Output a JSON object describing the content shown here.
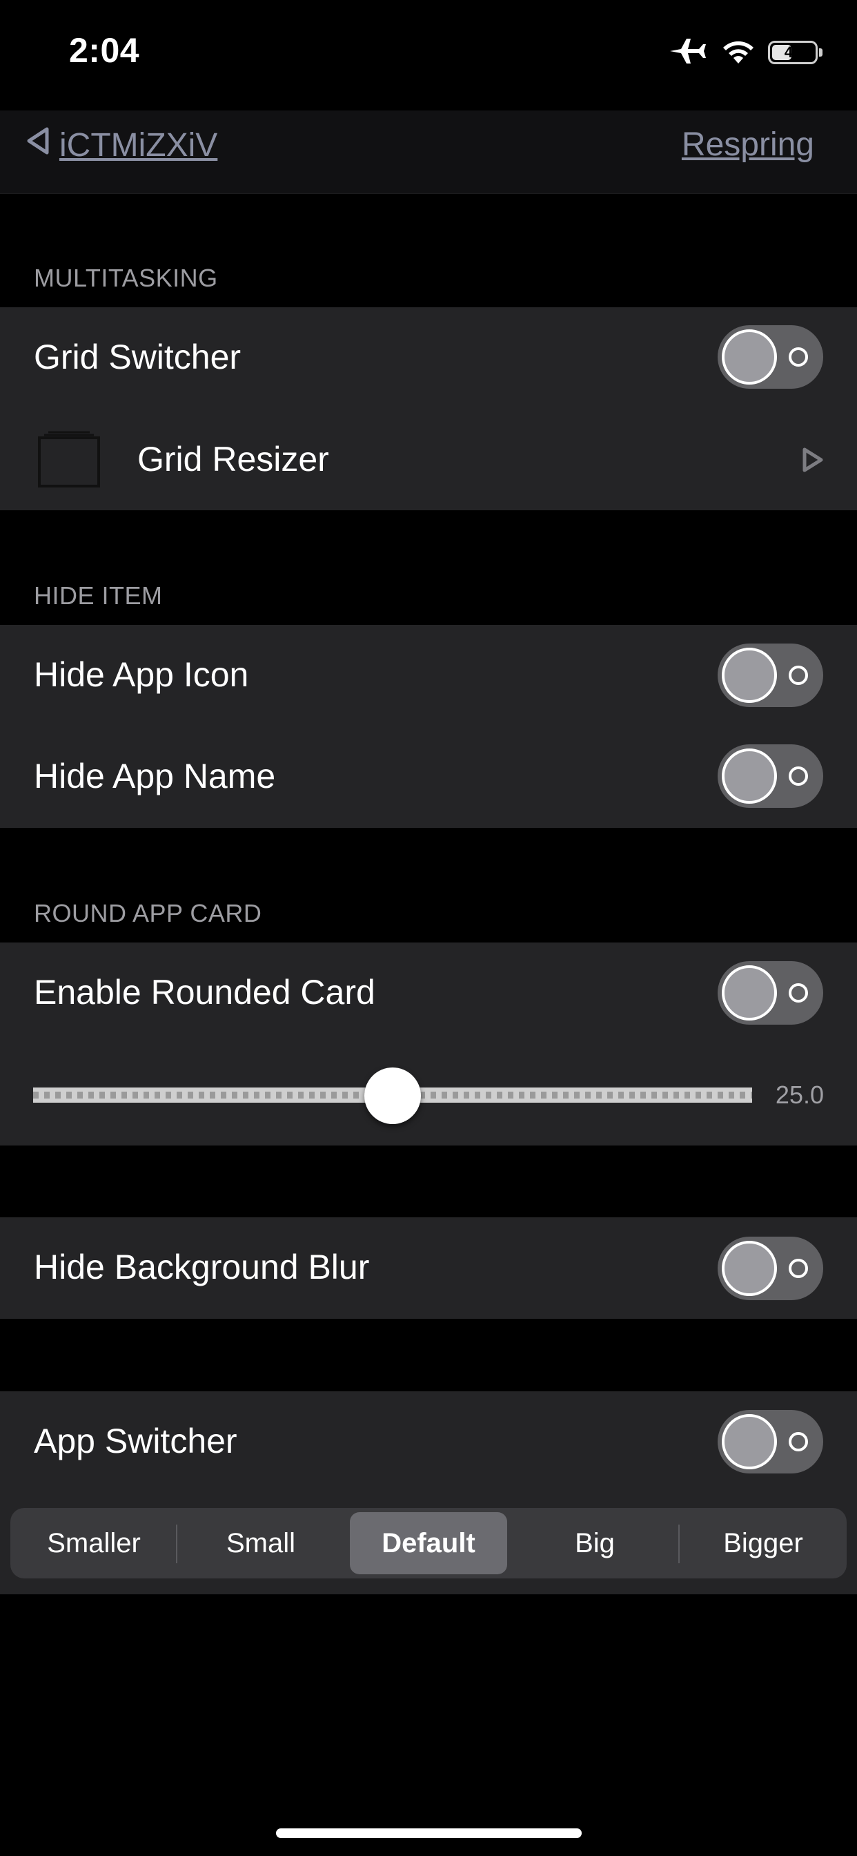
{
  "status_bar": {
    "time": "2:04",
    "battery_level": "43",
    "airplane_icon": "airplane-icon",
    "wifi_icon": "wifi-icon"
  },
  "nav": {
    "back_label": "iCTMiZXiV",
    "back_icon": "back-triangle-icon",
    "right_button": "Respring"
  },
  "sections": {
    "multitasking": {
      "header": "MULTITASKING",
      "grid_switcher": "Grid Switcher",
      "grid_resizer": "Grid Resizer"
    },
    "hide_item": {
      "header": "HIDE ITEM",
      "hide_app_icon": "Hide App Icon",
      "hide_app_name": "Hide App Name"
    },
    "round_app_card": {
      "header": "ROUND APP CARD",
      "enable_rounded_card": "Enable Rounded Card",
      "slider_value": "25.0"
    },
    "background": {
      "hide_background_blur": "Hide Background Blur"
    },
    "app_switcher": {
      "label": "App Switcher",
      "segments": [
        "Smaller",
        "Small",
        "Default",
        "Big",
        "Bigger"
      ],
      "selected": "Default"
    }
  },
  "toggles": {
    "grid_switcher": false,
    "hide_app_icon": false,
    "hide_app_name": false,
    "enable_rounded_card": false,
    "hide_background_blur": false,
    "app_switcher": false
  },
  "slider": {
    "value": 25.0,
    "fraction": 0.5
  },
  "colors": {
    "group_bg": "#242426",
    "link": "#8a8fa3",
    "header": "#9d9da2"
  }
}
